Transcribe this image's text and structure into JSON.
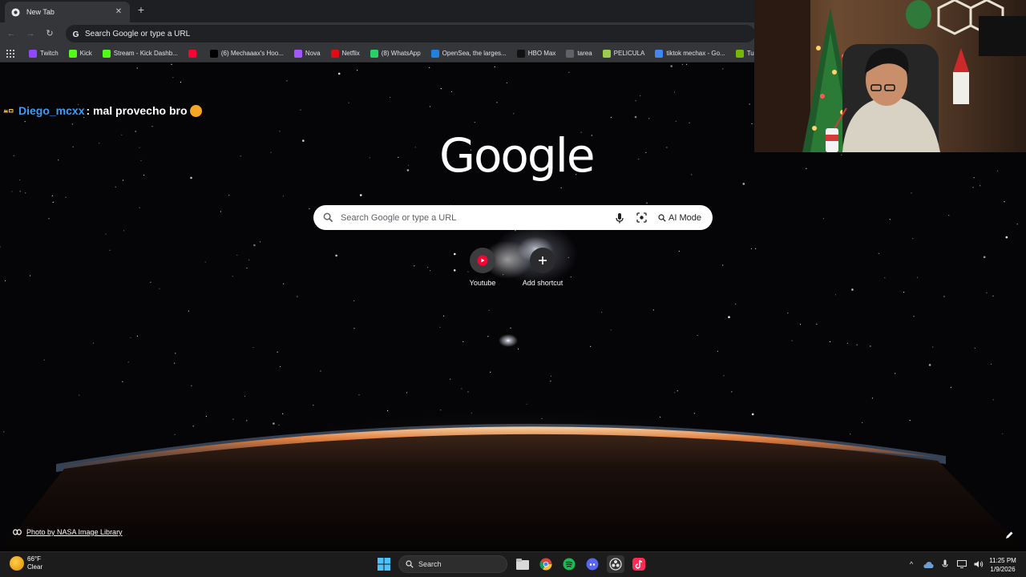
{
  "browser": {
    "tab": {
      "title": "New Tab",
      "close_icon": "close-icon"
    },
    "omnibox_text": "Search Google or type a URL",
    "bookmarks": [
      {
        "label": "Twitch",
        "icon": "twitch-icon",
        "color": "#9146ff"
      },
      {
        "label": "Kick",
        "icon": "kick-icon",
        "color": "#53fc18"
      },
      {
        "label": "Stream - Kick Dashb...",
        "icon": "kick-icon",
        "color": "#53fc18"
      },
      {
        "label": "",
        "icon": "youtube-icon",
        "color": "#ff0033"
      },
      {
        "label": "(6) Mechaaax's Hoo...",
        "icon": "x-icon",
        "color": "#000000"
      },
      {
        "label": "Nova",
        "icon": "nova-icon",
        "color": "#a259ff"
      },
      {
        "label": "Netflix",
        "icon": "netflix-icon",
        "color": "#e50914"
      },
      {
        "label": "(8) WhatsApp",
        "icon": "whatsapp-icon",
        "color": "#25d366"
      },
      {
        "label": "OpenSea, the larges...",
        "icon": "opensea-icon",
        "color": "#2081e2"
      },
      {
        "label": "HBO Max",
        "icon": "hbomax-icon",
        "color": "#111111"
      },
      {
        "label": "tarea",
        "icon": "globe-icon",
        "color": "#5f6368"
      },
      {
        "label": "PELICULA",
        "icon": "pelicula-icon",
        "color": "#9ccc4a"
      },
      {
        "label": "tiktok mechax - Go...",
        "icon": "google-drive-icon",
        "color": "#4285f4"
      },
      {
        "label": "Turn Your S",
        "icon": "nvidia-icon",
        "color": "#76b900"
      }
    ]
  },
  "chat": {
    "username": "Diego_mcxx",
    "message": ": mal provecho bro"
  },
  "ntp": {
    "logo": "Google",
    "search_placeholder": "Search Google or type a URL",
    "ai_mode_label": "AI Mode",
    "shortcuts": [
      {
        "label": "Youtube",
        "icon": "youtube-icon"
      },
      {
        "label": "Add shortcut",
        "icon": "plus-icon"
      }
    ],
    "photo_credit": "Photo by NASA Image Library"
  },
  "taskbar": {
    "weather_temp": "66°F",
    "weather_desc": "Clear",
    "search_label": "Search",
    "time": "11:25 PM",
    "date": "1/9/2026"
  },
  "colors": {
    "chrome_dark": "#35363a",
    "chat_username": "#3e9cf5",
    "youtube_red": "#ff0033"
  }
}
